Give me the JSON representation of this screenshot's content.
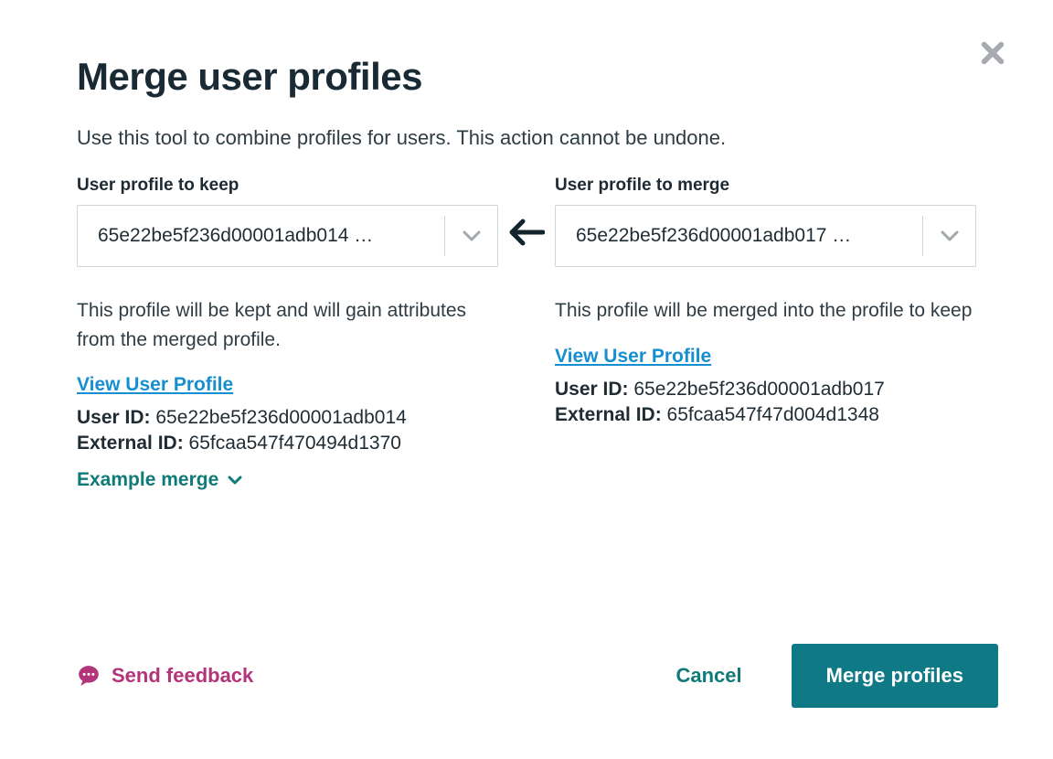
{
  "dialog": {
    "title": "Merge user profiles",
    "subtitle": "Use this tool to combine profiles for users. This action cannot be undone."
  },
  "keep": {
    "label": "User profile to keep",
    "select_value": "65e22be5f236d00001adb014 …",
    "description": "This profile will be kept and will gain attributes from the merged profile.",
    "view_link": "View User Profile",
    "user_id_label": "User ID:",
    "user_id": "65e22be5f236d00001adb014",
    "external_id_label": "External ID:",
    "external_id": "65fcaa547f470494d1370"
  },
  "merge": {
    "label": "User profile to merge",
    "select_value": "65e22be5f236d00001adb017 …",
    "description": "This profile will be merged into the profile to keep",
    "view_link": "View User Profile",
    "user_id_label": "User ID:",
    "user_id": "65e22be5f236d00001adb017",
    "external_id_label": "External ID:",
    "external_id": "65fcaa547f47d004d1348"
  },
  "example_toggle": "Example merge",
  "footer": {
    "feedback": "Send feedback",
    "cancel": "Cancel",
    "submit": "Merge profiles"
  }
}
